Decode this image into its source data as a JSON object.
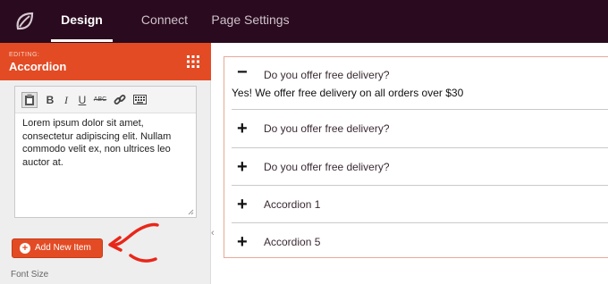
{
  "topbar": {
    "logo_icon": "leaf-logo-icon",
    "tabs": [
      {
        "label": "Design",
        "active": true
      },
      {
        "label": "Connect",
        "active": false
      },
      {
        "label": "Page Settings",
        "active": false
      }
    ]
  },
  "panel": {
    "editing_label": "EDITING:",
    "editing_title": "Accordion",
    "toolbar_icons": [
      "paste-icon",
      "bold-icon",
      "italic-icon",
      "underline-icon",
      "strikethrough-icon",
      "link-icon",
      "keyboard-icon"
    ],
    "toolbar_glyphs": {
      "bold": "B",
      "italic": "I",
      "underline": "U",
      "strike": "ABC"
    },
    "editor_text": "Lorem ipsum dolor sit amet, consectetur adipiscing elit. Nullam commodo velit ex, non ultrices leo auctor at.",
    "add_button": "Add New Item",
    "add_button_icon": "+",
    "font_size_label": "Font Size",
    "collapse_glyph": "‹"
  },
  "accordion": {
    "items": [
      {
        "title": "Do you offer free delivery?",
        "expanded": true,
        "content": "Yes! We offer free delivery on all orders over $30",
        "sign": "−"
      },
      {
        "title": "Do you offer free delivery?",
        "expanded": false,
        "sign": "+"
      },
      {
        "title": "Do you offer free delivery?",
        "expanded": false,
        "sign": "+"
      },
      {
        "title": "Accordion 1",
        "expanded": false,
        "sign": "+"
      },
      {
        "title": "Accordion 5",
        "expanded": false,
        "sign": "+"
      }
    ]
  },
  "colors": {
    "topbar": "#2a0a1e",
    "accent": "#e34b24",
    "annotation_arrow": "#e8271a"
  }
}
